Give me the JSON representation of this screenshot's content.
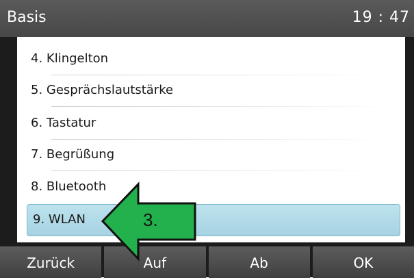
{
  "header": {
    "title": "Basis",
    "time": "19 : 47"
  },
  "menu": {
    "items": [
      {
        "label": "4. Klingelton"
      },
      {
        "label": "5. Gesprächslautstärke"
      },
      {
        "label": "6. Tastatur"
      },
      {
        "label": "7. Begrüßung"
      },
      {
        "label": "8. Bluetooth"
      },
      {
        "label": "9. WLAN",
        "selected": true
      }
    ]
  },
  "softkeys": {
    "back": "Zurück",
    "up": "Auf",
    "down": "Ab",
    "ok": "OK"
  },
  "annotation": {
    "step_label": "3.",
    "arrow_color": "#22b14c"
  },
  "colors": {
    "selection": "#b5dcea",
    "titlebar": "#4f4f4f"
  }
}
